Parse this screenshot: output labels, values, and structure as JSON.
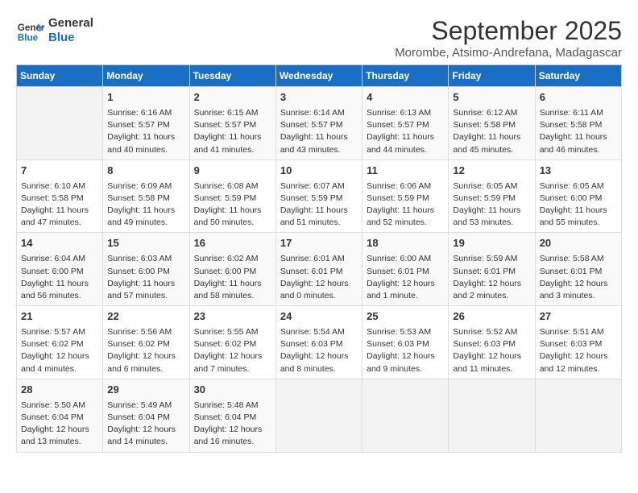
{
  "logo": {
    "line1": "General",
    "line2": "Blue"
  },
  "title": "September 2025",
  "subtitle": "Morombe, Atsimo-Andrefana, Madagascar",
  "headers": [
    "Sunday",
    "Monday",
    "Tuesday",
    "Wednesday",
    "Thursday",
    "Friday",
    "Saturday"
  ],
  "weeks": [
    [
      {
        "day": "",
        "text": ""
      },
      {
        "day": "1",
        "text": "Sunrise: 6:16 AM\nSunset: 5:57 PM\nDaylight: 11 hours\nand 40 minutes."
      },
      {
        "day": "2",
        "text": "Sunrise: 6:15 AM\nSunset: 5:57 PM\nDaylight: 11 hours\nand 41 minutes."
      },
      {
        "day": "3",
        "text": "Sunrise: 6:14 AM\nSunset: 5:57 PM\nDaylight: 11 hours\nand 43 minutes."
      },
      {
        "day": "4",
        "text": "Sunrise: 6:13 AM\nSunset: 5:57 PM\nDaylight: 11 hours\nand 44 minutes."
      },
      {
        "day": "5",
        "text": "Sunrise: 6:12 AM\nSunset: 5:58 PM\nDaylight: 11 hours\nand 45 minutes."
      },
      {
        "day": "6",
        "text": "Sunrise: 6:11 AM\nSunset: 5:58 PM\nDaylight: 11 hours\nand 46 minutes."
      }
    ],
    [
      {
        "day": "7",
        "text": "Sunrise: 6:10 AM\nSunset: 5:58 PM\nDaylight: 11 hours\nand 47 minutes."
      },
      {
        "day": "8",
        "text": "Sunrise: 6:09 AM\nSunset: 5:58 PM\nDaylight: 11 hours\nand 49 minutes."
      },
      {
        "day": "9",
        "text": "Sunrise: 6:08 AM\nSunset: 5:59 PM\nDaylight: 11 hours\nand 50 minutes."
      },
      {
        "day": "10",
        "text": "Sunrise: 6:07 AM\nSunset: 5:59 PM\nDaylight: 11 hours\nand 51 minutes."
      },
      {
        "day": "11",
        "text": "Sunrise: 6:06 AM\nSunset: 5:59 PM\nDaylight: 11 hours\nand 52 minutes."
      },
      {
        "day": "12",
        "text": "Sunrise: 6:05 AM\nSunset: 5:59 PM\nDaylight: 11 hours\nand 53 minutes."
      },
      {
        "day": "13",
        "text": "Sunrise: 6:05 AM\nSunset: 6:00 PM\nDaylight: 11 hours\nand 55 minutes."
      }
    ],
    [
      {
        "day": "14",
        "text": "Sunrise: 6:04 AM\nSunset: 6:00 PM\nDaylight: 11 hours\nand 56 minutes."
      },
      {
        "day": "15",
        "text": "Sunrise: 6:03 AM\nSunset: 6:00 PM\nDaylight: 11 hours\nand 57 minutes."
      },
      {
        "day": "16",
        "text": "Sunrise: 6:02 AM\nSunset: 6:00 PM\nDaylight: 11 hours\nand 58 minutes."
      },
      {
        "day": "17",
        "text": "Sunrise: 6:01 AM\nSunset: 6:01 PM\nDaylight: 12 hours\nand 0 minutes."
      },
      {
        "day": "18",
        "text": "Sunrise: 6:00 AM\nSunset: 6:01 PM\nDaylight: 12 hours\nand 1 minute."
      },
      {
        "day": "19",
        "text": "Sunrise: 5:59 AM\nSunset: 6:01 PM\nDaylight: 12 hours\nand 2 minutes."
      },
      {
        "day": "20",
        "text": "Sunrise: 5:58 AM\nSunset: 6:01 PM\nDaylight: 12 hours\nand 3 minutes."
      }
    ],
    [
      {
        "day": "21",
        "text": "Sunrise: 5:57 AM\nSunset: 6:02 PM\nDaylight: 12 hours\nand 4 minutes."
      },
      {
        "day": "22",
        "text": "Sunrise: 5:56 AM\nSunset: 6:02 PM\nDaylight: 12 hours\nand 6 minutes."
      },
      {
        "day": "23",
        "text": "Sunrise: 5:55 AM\nSunset: 6:02 PM\nDaylight: 12 hours\nand 7 minutes."
      },
      {
        "day": "24",
        "text": "Sunrise: 5:54 AM\nSunset: 6:03 PM\nDaylight: 12 hours\nand 8 minutes."
      },
      {
        "day": "25",
        "text": "Sunrise: 5:53 AM\nSunset: 6:03 PM\nDaylight: 12 hours\nand 9 minutes."
      },
      {
        "day": "26",
        "text": "Sunrise: 5:52 AM\nSunset: 6:03 PM\nDaylight: 12 hours\nand 11 minutes."
      },
      {
        "day": "27",
        "text": "Sunrise: 5:51 AM\nSunset: 6:03 PM\nDaylight: 12 hours\nand 12 minutes."
      }
    ],
    [
      {
        "day": "28",
        "text": "Sunrise: 5:50 AM\nSunset: 6:04 PM\nDaylight: 12 hours\nand 13 minutes."
      },
      {
        "day": "29",
        "text": "Sunrise: 5:49 AM\nSunset: 6:04 PM\nDaylight: 12 hours\nand 14 minutes."
      },
      {
        "day": "30",
        "text": "Sunrise: 5:48 AM\nSunset: 6:04 PM\nDaylight: 12 hours\nand 16 minutes."
      },
      {
        "day": "",
        "text": ""
      },
      {
        "day": "",
        "text": ""
      },
      {
        "day": "",
        "text": ""
      },
      {
        "day": "",
        "text": ""
      }
    ]
  ]
}
